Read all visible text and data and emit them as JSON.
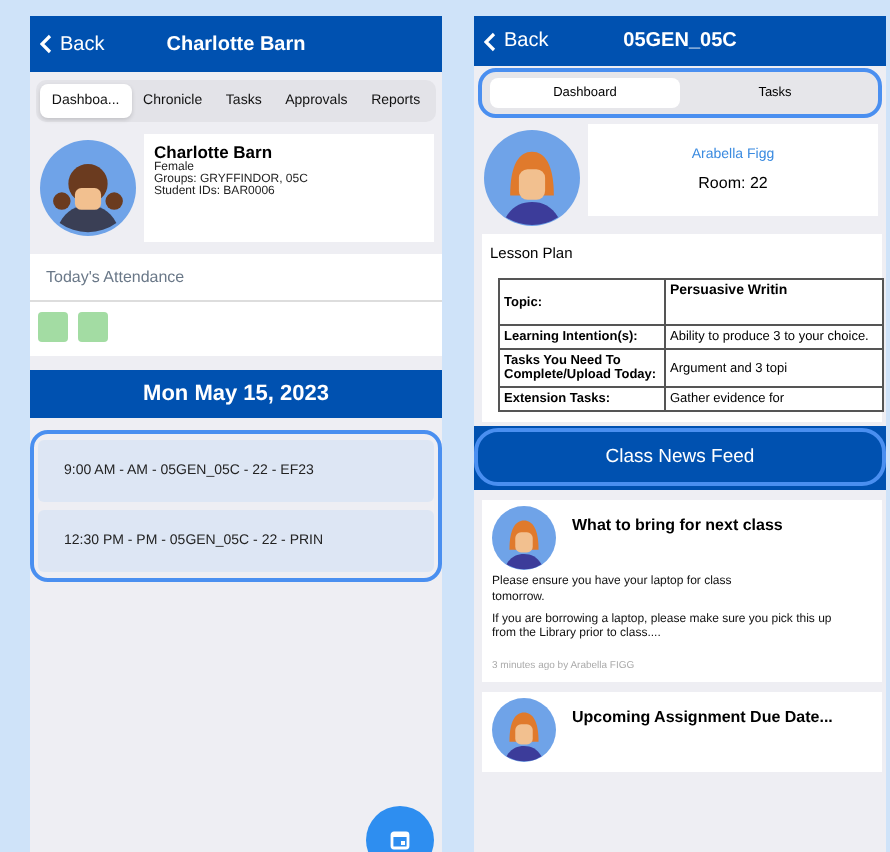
{
  "student_screen": {
    "header": {
      "back": "Back",
      "title": "Charlotte  Barn"
    },
    "tabs": [
      {
        "label": "Dashboa...",
        "selected": true
      },
      {
        "label": "Chronicle",
        "selected": false
      },
      {
        "label": "Tasks",
        "selected": false
      },
      {
        "label": "Approvals",
        "selected": false
      },
      {
        "label": "Reports",
        "selected": false
      }
    ],
    "profile": {
      "name": "Charlotte  Barn",
      "gender": "Female",
      "groups": "Groups: GRYFFINDOR, 05C",
      "ids": "Student IDs: BAR0006"
    },
    "attendance": {
      "label": "Today's Attendance",
      "marks": [
        {
          "color": "#a3dca3"
        },
        {
          "color": "#a3dca3"
        }
      ]
    },
    "date": "Mon May 15, 2023",
    "classes": [
      "9:00 AM - AM - 05GEN_05C - 22 - EF23",
      "12:30 PM - PM - 05GEN_05C - 22 - PRIN"
    ]
  },
  "class_screen": {
    "header": {
      "back": "Back",
      "title": "05GEN_05C"
    },
    "tabs": [
      {
        "label": "Dashboard",
        "selected": true
      },
      {
        "label": "Tasks",
        "selected": false
      }
    ],
    "teacher": {
      "name": "Arabella Figg",
      "room": "Room: 22"
    },
    "lesson_plan": {
      "title": "Lesson Plan",
      "rows": [
        {
          "label": "Topic:",
          "value": "Persuasive Writin",
          "bold": true
        },
        {
          "label": "Learning Intention(s):",
          "value": "Ability to produce 3 to your choice.",
          "bold": false
        },
        {
          "label": "Tasks You Need To Complete/Upload Today:",
          "value": "Argument and 3 topi",
          "bold": false
        },
        {
          "label": "Extension Tasks:",
          "value": "Gather evidence for",
          "bold": false
        }
      ]
    },
    "news_button": "Class News Feed",
    "posts": [
      {
        "title": "What to bring for next class",
        "paragraphs": [
          "Please ensure you have your laptop for class tomorrow.",
          "If you are borrowing a laptop, please make sure you pick this up from the Library prior to class...."
        ],
        "meta": "3 minutes ago by Arabella FIGG"
      },
      {
        "title": "Upcoming Assignment Due Date..."
      }
    ]
  }
}
